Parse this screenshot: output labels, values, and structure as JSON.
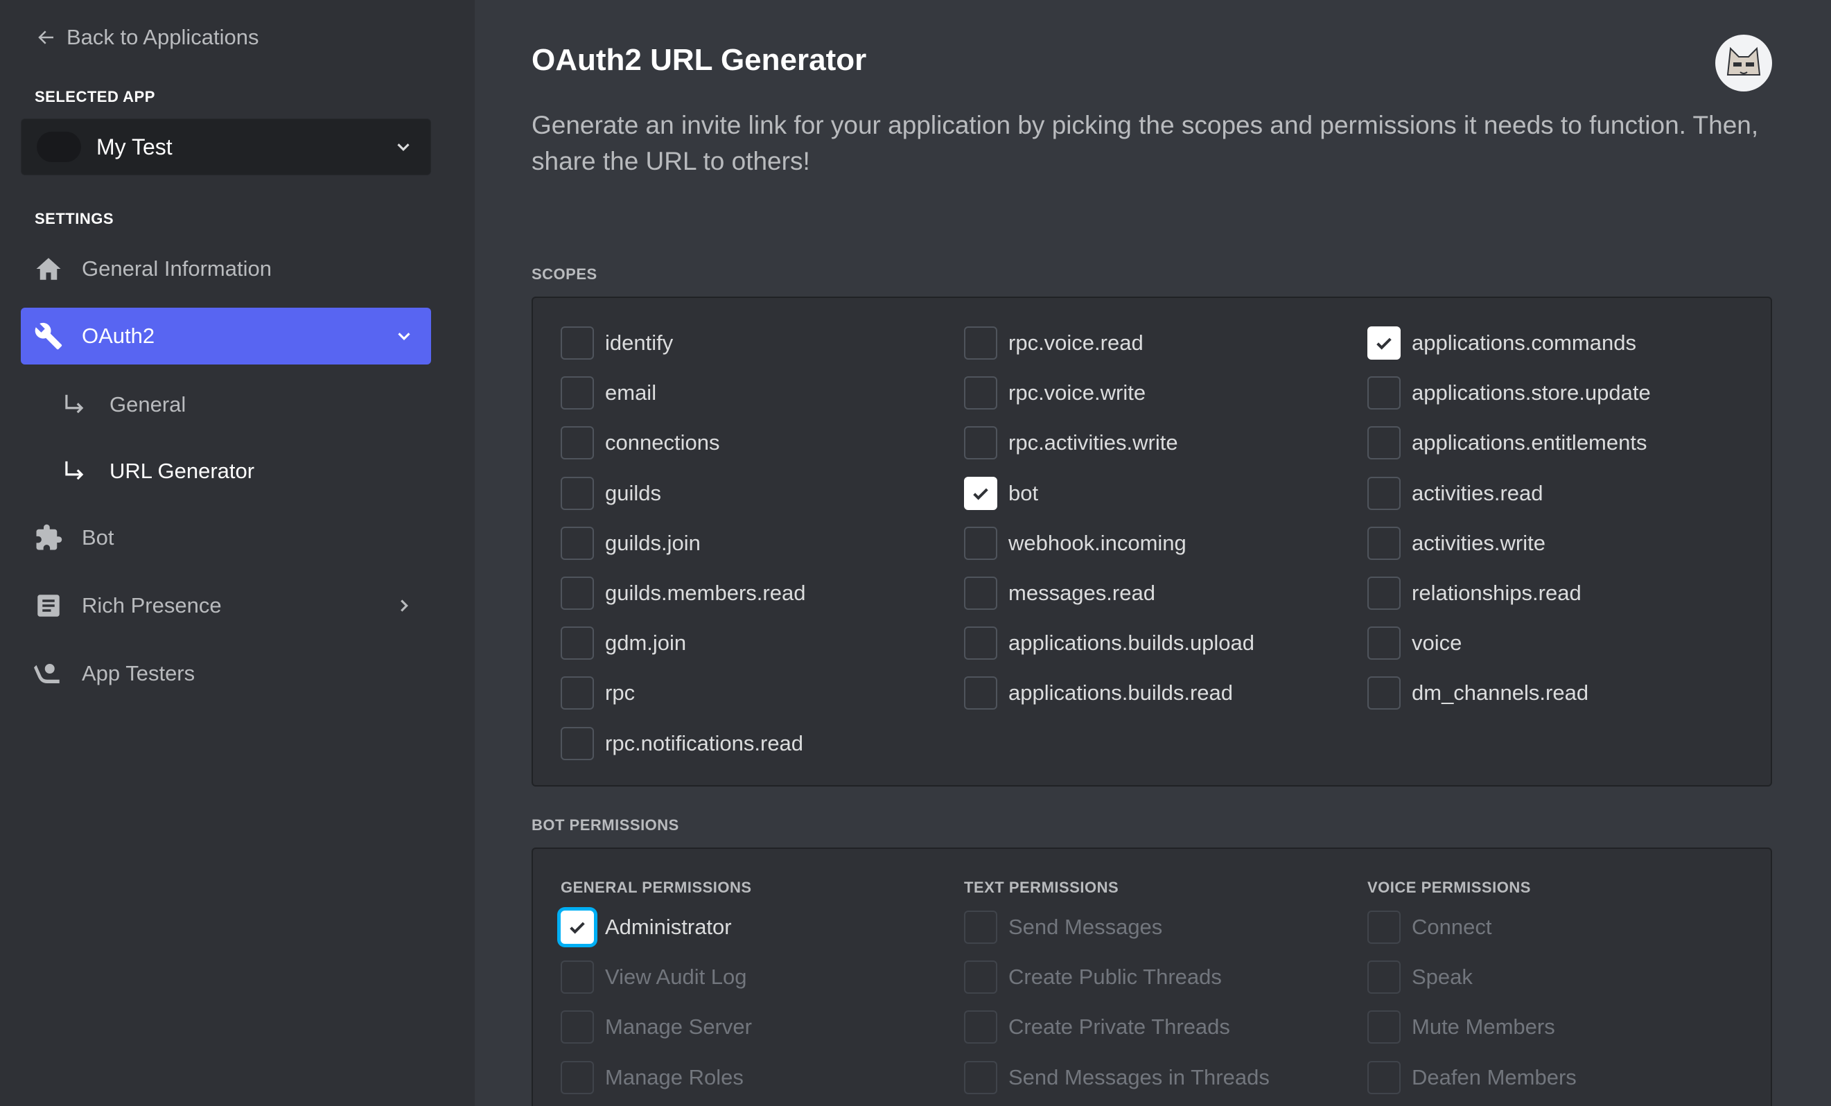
{
  "sidebar": {
    "back_label": "Back to Applications",
    "selected_app_heading": "SELECTED APP",
    "selected_app_name": "My Test",
    "settings_heading": "SETTINGS",
    "nav": {
      "general_information": "General Information",
      "oauth2": "OAuth2",
      "oauth2_general": "General",
      "oauth2_url_generator": "URL Generator",
      "bot": "Bot",
      "rich_presence": "Rich Presence",
      "app_testers": "App Testers"
    },
    "active_color": "#5865f2"
  },
  "main": {
    "title": "OAuth2 URL Generator",
    "description": "Generate an invite link for your application by picking the scopes and permissions it needs to function. Then, share the URL to others!",
    "scopes_heading": "SCOPES",
    "scopes": {
      "col1": [
        {
          "label": "identify",
          "checked": false
        },
        {
          "label": "email",
          "checked": false
        },
        {
          "label": "connections",
          "checked": false
        },
        {
          "label": "guilds",
          "checked": false
        },
        {
          "label": "guilds.join",
          "checked": false
        },
        {
          "label": "guilds.members.read",
          "checked": false
        },
        {
          "label": "gdm.join",
          "checked": false
        },
        {
          "label": "rpc",
          "checked": false
        },
        {
          "label": "rpc.notifications.read",
          "checked": false
        }
      ],
      "col2": [
        {
          "label": "rpc.voice.read",
          "checked": false
        },
        {
          "label": "rpc.voice.write",
          "checked": false
        },
        {
          "label": "rpc.activities.write",
          "checked": false
        },
        {
          "label": "bot",
          "checked": true
        },
        {
          "label": "webhook.incoming",
          "checked": false
        },
        {
          "label": "messages.read",
          "checked": false
        },
        {
          "label": "applications.builds.upload",
          "checked": false
        },
        {
          "label": "applications.builds.read",
          "checked": false
        }
      ],
      "col3": [
        {
          "label": "applications.commands",
          "checked": true
        },
        {
          "label": "applications.store.update",
          "checked": false
        },
        {
          "label": "applications.entitlements",
          "checked": false
        },
        {
          "label": "activities.read",
          "checked": false
        },
        {
          "label": "activities.write",
          "checked": false
        },
        {
          "label": "relationships.read",
          "checked": false
        },
        {
          "label": "voice",
          "checked": false
        },
        {
          "label": "dm_channels.read",
          "checked": false
        }
      ]
    },
    "bot_permissions_heading": "BOT PERMISSIONS",
    "permissions": {
      "general_heading": "GENERAL PERMISSIONS",
      "text_heading": "TEXT PERMISSIONS",
      "voice_heading": "VOICE PERMISSIONS",
      "general": [
        {
          "label": "Administrator",
          "checked": true
        },
        {
          "label": "View Audit Log",
          "checked": false
        },
        {
          "label": "Manage Server",
          "checked": false
        },
        {
          "label": "Manage Roles",
          "checked": false
        }
      ],
      "text": [
        {
          "label": "Send Messages",
          "checked": false
        },
        {
          "label": "Create Public Threads",
          "checked": false
        },
        {
          "label": "Create Private Threads",
          "checked": false
        },
        {
          "label": "Send Messages in Threads",
          "checked": false
        }
      ],
      "voice": [
        {
          "label": "Connect",
          "checked": false
        },
        {
          "label": "Speak",
          "checked": false
        },
        {
          "label": "Mute Members",
          "checked": false
        },
        {
          "label": "Deafen Members",
          "checked": false
        }
      ]
    }
  }
}
